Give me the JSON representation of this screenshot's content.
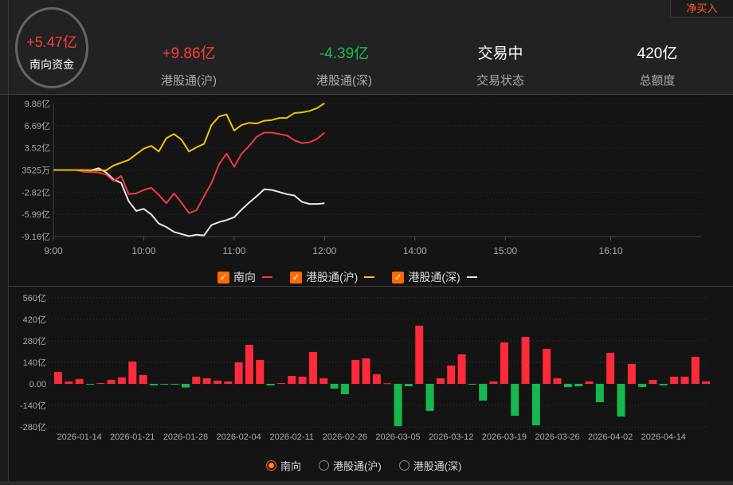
{
  "header": {
    "net_buy_button": "净买入",
    "southbound": {
      "value": "+5.47亿",
      "label": "南向资金"
    },
    "stats": [
      {
        "value": "+9.86亿",
        "label": "港股通(沪)",
        "color": "#ff3b3b"
      },
      {
        "value": "-4.39亿",
        "label": "港股通(深)",
        "color": "#1db954"
      },
      {
        "value": "交易中",
        "label": "交易状态",
        "color": "#ffffff"
      },
      {
        "value": "420亿",
        "label": "总额度",
        "color": "#ffffff"
      }
    ]
  },
  "chart_data": [
    {
      "type": "line",
      "title": "intraday flow",
      "yticks": [
        "9.86亿",
        "6.69亿",
        "3.52亿",
        "3525万",
        "-2.82亿",
        "-5.99亿",
        "-9.16亿"
      ],
      "ytick_values": [
        9.86,
        6.69,
        3.52,
        0.35,
        -2.82,
        -5.99,
        -9.16
      ],
      "xticks": [
        "9:00",
        "10:00",
        "11:00",
        "12:00",
        "14:00",
        "15:00",
        "16:10"
      ],
      "ylim": [
        -9.16,
        9.86
      ],
      "x_minutes": [
        0,
        5,
        10,
        15,
        20,
        25,
        30,
        35,
        40,
        45,
        50,
        55,
        60,
        65,
        70,
        75,
        80,
        85,
        90,
        95,
        100,
        105,
        110,
        115,
        120,
        125,
        130,
        135,
        140,
        145,
        150,
        155,
        160,
        165,
        170,
        175,
        180
      ],
      "series": [
        {
          "name": "南向",
          "color": "#ee3b44",
          "values": [
            0.35,
            0.35,
            0.35,
            0.35,
            0.1,
            0.05,
            0.0,
            -0.3,
            -1.2,
            -0.5,
            -3.1,
            -3.0,
            -2.5,
            -2.2,
            -3.2,
            -4.4,
            -3.0,
            -4.3,
            -5.8,
            -5.4,
            -3.4,
            -1.5,
            1.2,
            2.7,
            0.8,
            2.7,
            3.8,
            5.1,
            5.7,
            5.7,
            5.5,
            5.3,
            4.6,
            4.2,
            4.3,
            4.8,
            5.7
          ]
        },
        {
          "name": "港股通(沪)",
          "color": "#f2c500",
          "values": [
            0.35,
            0.35,
            0.35,
            0.35,
            0.35,
            0.3,
            0.3,
            0.3,
            1.0,
            1.4,
            1.8,
            2.6,
            3.4,
            3.8,
            3.0,
            4.9,
            5.5,
            4.7,
            3.0,
            3.6,
            4.1,
            6.8,
            8.0,
            8.3,
            6.0,
            6.8,
            7.1,
            7.0,
            7.4,
            7.5,
            7.8,
            7.8,
            8.5,
            8.6,
            8.8,
            9.2,
            9.9
          ]
        },
        {
          "name": "港股通(深)",
          "color": "#e8e8e8",
          "values": [
            0.35,
            0.35,
            0.35,
            0.35,
            0.35,
            0.3,
            0.6,
            0.0,
            -1.0,
            -1.5,
            -4.1,
            -5.5,
            -5.2,
            -6.0,
            -7.3,
            -7.8,
            -8.5,
            -8.8,
            -9.1,
            -8.9,
            -9.0,
            -7.5,
            -7.1,
            -6.8,
            -6.4,
            -5.3,
            -4.3,
            -3.4,
            -2.4,
            -2.5,
            -2.8,
            -3.1,
            -3.3,
            -4.2,
            -4.5,
            -4.5,
            -4.4
          ]
        }
      ],
      "legend": [
        {
          "name": "南向",
          "checked": true
        },
        {
          "name": "港股通(沪)",
          "checked": true
        },
        {
          "name": "港股通(深)",
          "checked": true
        }
      ],
      "legend_placement": "bottom"
    },
    {
      "type": "bar",
      "title": "daily southbound net buy",
      "yticks": [
        "560亿",
        "420亿",
        "280亿",
        "140亿",
        "0.00",
        "-140亿",
        "-280亿"
      ],
      "ytick_values": [
        560,
        420,
        280,
        140,
        0,
        -140,
        -280
      ],
      "ylim": [
        -280,
        560
      ],
      "xticks": [
        "2026-01-14",
        "2026-01-21",
        "2026-01-28",
        "2026-02-04",
        "2026-02-11",
        "2026-02-26",
        "2026-03-05",
        "2026-03-12",
        "2026-03-19",
        "2026-03-26",
        "2026-04-02",
        "2026-04-14"
      ],
      "values": [
        78,
        16,
        31,
        -5,
        5,
        26,
        42,
        145,
        57,
        -10,
        -5,
        -5,
        -24,
        47,
        36,
        21,
        16,
        140,
        254,
        156,
        -10,
        5,
        52,
        47,
        208,
        36,
        -31,
        -67,
        156,
        166,
        62,
        4,
        -275,
        -16,
        379,
        -176,
        36,
        119,
        192,
        -5,
        -109,
        16,
        270,
        -208,
        306,
        -270,
        228,
        36,
        -21,
        -16,
        16,
        -119,
        202,
        -213,
        130,
        -21,
        26,
        -10,
        47,
        47,
        176,
        16
      ],
      "colors": {
        "positive": "#ff2a3a",
        "negative": "#17b84e"
      },
      "legend": [
        {
          "name": "南向",
          "selected": true
        },
        {
          "name": "港股通(沪)",
          "selected": false
        },
        {
          "name": "港股通(深)",
          "selected": false
        }
      ],
      "legend_placement": "bottom"
    }
  ]
}
